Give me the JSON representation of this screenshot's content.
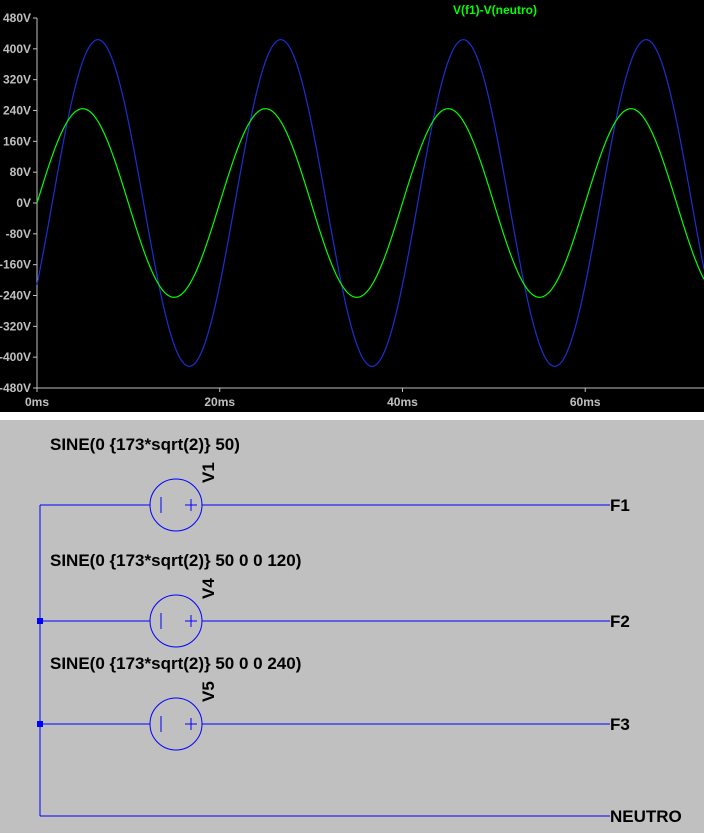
{
  "waveform": {
    "background": "#000000",
    "axis_color": "#c0c0c0",
    "trace_label": "V(f1)-V(neutro)",
    "trace_label_color": "#00ff00",
    "chart_data": {
      "type": "line",
      "xlabel": "",
      "ylabel": "",
      "x_ticks": [
        "0ms",
        "20ms",
        "40ms",
        "60ms"
      ],
      "x_tick_values": [
        0,
        20,
        40,
        60
      ],
      "y_ticks": [
        "480V",
        "400V",
        "320V",
        "240V",
        "160V",
        "80V",
        "0V",
        "-80V",
        "-160V",
        "-240V",
        "-320V",
        "-400V",
        "-480V"
      ],
      "y_tick_values": [
        480,
        400,
        320,
        240,
        160,
        80,
        0,
        -80,
        -160,
        -240,
        -320,
        -400,
        -480
      ],
      "xlim": [
        0,
        73
      ],
      "ylim": [
        -480,
        480
      ],
      "series": [
        {
          "name": "V(f1)-V(neutro)",
          "color": "#00ff00",
          "amplitude": 244.7,
          "frequency_hz": 50,
          "phase_deg": 0,
          "offset": 0,
          "x": [
            0,
            5,
            10,
            15,
            20,
            25,
            30,
            35,
            40,
            45,
            50,
            55,
            60,
            65,
            70
          ],
          "y": [
            0,
            245,
            0,
            -245,
            0,
            245,
            0,
            -245,
            0,
            245,
            0,
            -245,
            0,
            245,
            0
          ]
        },
        {
          "color": "#1c2fd0",
          "amplitude": 423.8,
          "frequency_hz": 50,
          "phase_deg": -30,
          "offset": 0,
          "x": [
            0,
            6.7,
            16.7,
            26.7,
            36.7,
            46.7,
            56.7,
            66.7
          ],
          "y": [
            -212,
            424,
            -424,
            424,
            -424,
            424,
            -424,
            424
          ]
        }
      ]
    }
  },
  "schematic": {
    "background": "#c0c0c0",
    "wire_color": "#0000ff",
    "sources": [
      {
        "name": "V1",
        "expression": "SINE(0 {173*sqrt(2)} 50)",
        "net": "F1"
      },
      {
        "name": "V4",
        "expression": "SINE(0 {173*sqrt(2)} 50 0 0 120)",
        "net": "F2"
      },
      {
        "name": "V5",
        "expression": "SINE(0 {173*sqrt(2)} 50 0 0 240)",
        "net": "F3"
      }
    ],
    "neutral_net": "NEUTRO",
    "symbol_minus": "|",
    "symbol_plus": "+"
  }
}
